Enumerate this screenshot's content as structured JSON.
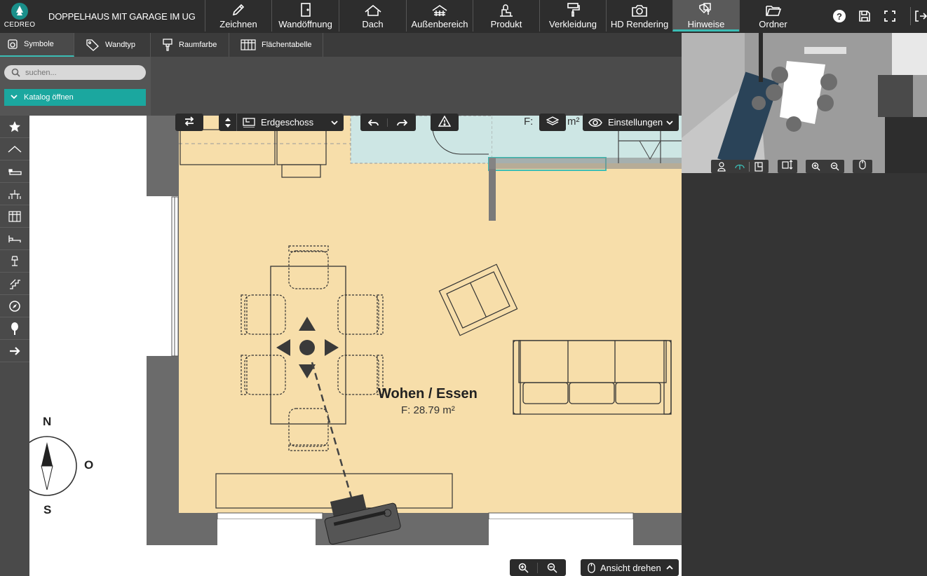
{
  "app": {
    "logo_text": "CEDREO",
    "project_title": "DOPPELHAUS MIT GARAGE IM UG"
  },
  "toolbar": {
    "tools": [
      {
        "label": "Zeichnen",
        "icon": "pencil-icon"
      },
      {
        "label": "Wandöffnung",
        "icon": "door-icon"
      },
      {
        "label": "Dach",
        "icon": "roof-icon"
      },
      {
        "label": "Außenbereich",
        "icon": "outdoor-icon"
      },
      {
        "label": "Produkt",
        "icon": "product-icon"
      },
      {
        "label": "Verkleidung",
        "icon": "paint-roller-icon"
      },
      {
        "label": "HD Rendering",
        "icon": "camera-icon"
      },
      {
        "label": "Hinweise",
        "icon": "tags-icon",
        "active": true
      },
      {
        "label": "Ordner",
        "icon": "folder-icon"
      }
    ],
    "right_icons": [
      "help-icon",
      "save-icon",
      "fullscreen-icon",
      "exit-icon"
    ]
  },
  "subtabs": [
    {
      "label": "Symbole",
      "icon": "symbols-icon",
      "active": true
    },
    {
      "label": "Wandtyp",
      "icon": "tag-icon"
    },
    {
      "label": "Raumfarbe",
      "icon": "paintbrush-icon"
    },
    {
      "label": "Flächentabelle",
      "icon": "table-icon"
    }
  ],
  "panel": {
    "search_placeholder": "suchen...",
    "catalog_label": "Katalog öffnen"
  },
  "side_icons": [
    "star-icon",
    "roof-line-icon",
    "sofa-icon",
    "dining-icon",
    "cabinet-icon",
    "bed-icon",
    "lamp-icon",
    "stairs-icon",
    "compass-icon",
    "tree-icon",
    "arrow-right-icon"
  ],
  "canvas_toolbar": {
    "level": "Erdgeschoss",
    "settings": "Einstellungen",
    "partial_area": "F:",
    "partial_area_unit": "m²"
  },
  "room": {
    "name": "Wohen / Essen",
    "area": "F: 28.79 m²"
  },
  "compass": {
    "north": "N",
    "east": "O",
    "south": "S"
  },
  "bottom": {
    "rotate_label": "Ansicht drehen"
  },
  "colors": {
    "accent": "#3bbdb5",
    "room_fill": "#f7deaa",
    "wall": "#666666",
    "topbar": "#2d2d2d"
  }
}
